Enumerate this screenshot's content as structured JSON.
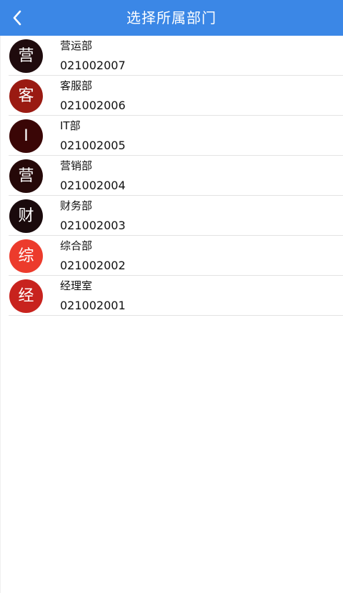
{
  "header": {
    "title": "选择所属部门"
  },
  "departments": [
    {
      "avatar_char": "营",
      "name": "营运部",
      "code": "021002007",
      "color": "#1f0b0d"
    },
    {
      "avatar_char": "客",
      "name": "客服部",
      "code": "021002006",
      "color": "#9a1a12"
    },
    {
      "avatar_char": "I",
      "name": "IT部",
      "code": "021002005",
      "color": "#3a0606"
    },
    {
      "avatar_char": "营",
      "name": "营销部",
      "code": "021002004",
      "color": "#250808"
    },
    {
      "avatar_char": "财",
      "name": "财务部",
      "code": "021002003",
      "color": "#1a0a0c"
    },
    {
      "avatar_char": "综",
      "name": "综合部",
      "code": "021002002",
      "color": "#ec3b2c"
    },
    {
      "avatar_char": "经",
      "name": "经理室",
      "code": "021002001",
      "color": "#c8231e"
    }
  ]
}
